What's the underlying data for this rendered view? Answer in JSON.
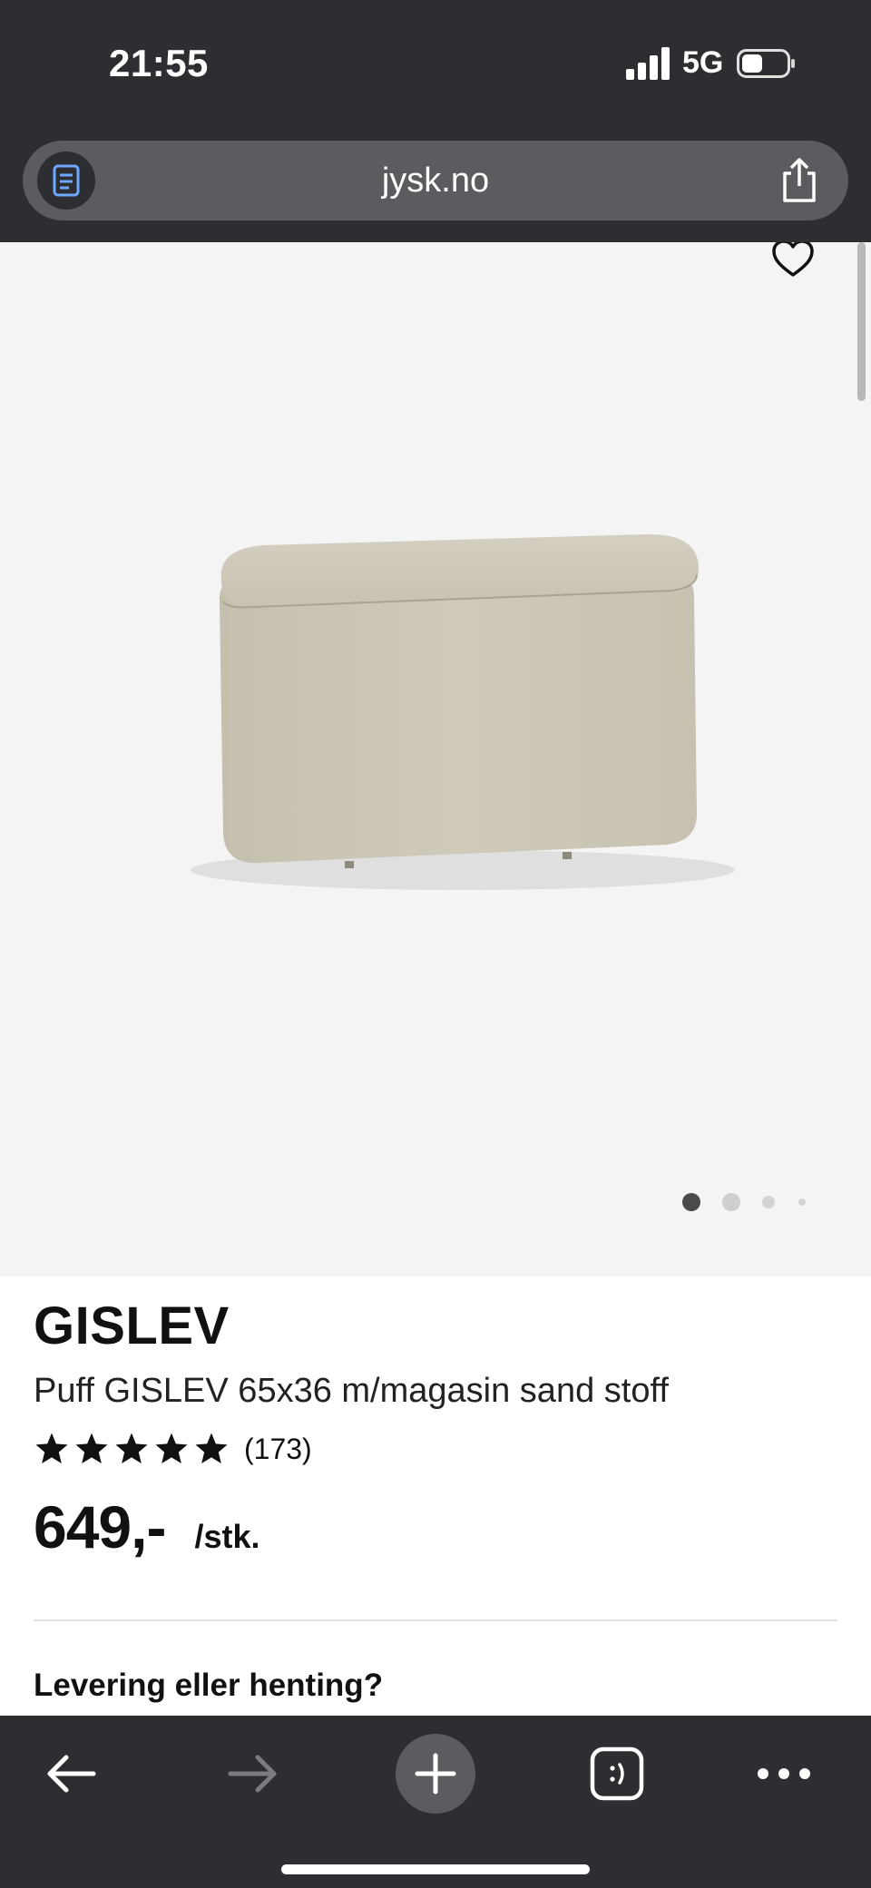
{
  "status_bar": {
    "time": "21:55",
    "network": "5G",
    "icons": [
      "signal-bars-icon",
      "battery-icon"
    ]
  },
  "browser": {
    "url": "jysk.no",
    "icons": [
      "reader-icon",
      "share-icon"
    ]
  },
  "gallery": {
    "image_alt": "Puff GISLEV 65x36 m/magasin sand stoff",
    "favorite_icon": "heart-outline-icon",
    "page_count": 4,
    "active_page": 1
  },
  "product": {
    "brand": "GISLEV",
    "title": "Puff GISLEV 65x36 m/magasin sand stoff",
    "rating_stars": 5,
    "rating_count": "(173)",
    "price": "649,-",
    "unit": "/stk."
  },
  "delivery": {
    "heading": "Levering eller henting?"
  },
  "toolbar": {
    "icons": [
      "back-arrow-icon",
      "forward-arrow-icon",
      "new-tab-plus-icon",
      "tabs-icon",
      "more-dots-icon"
    ]
  },
  "colors": {
    "chrome_bg": "#2c2e32",
    "url_bar_bg": "#5a5c60",
    "gallery_bg": "#f4f4f4",
    "product_fabric": "#c9c3b2"
  }
}
